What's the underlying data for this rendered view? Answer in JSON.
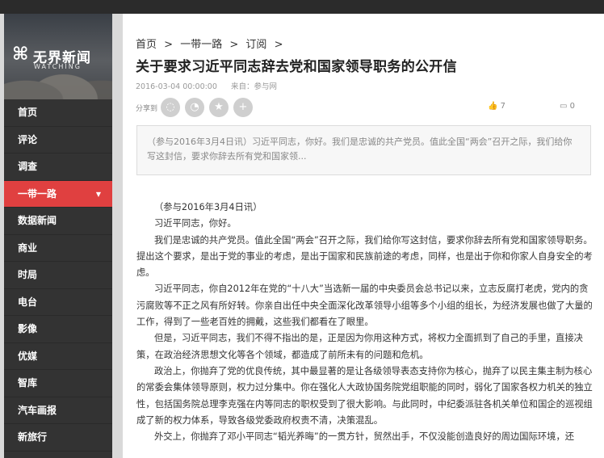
{
  "logo": {
    "name": "无界新闻",
    "sub": "WATCHING"
  },
  "nav": {
    "items": [
      {
        "label": "首页"
      },
      {
        "label": "评论"
      },
      {
        "label": "调查"
      },
      {
        "label": "一带一路",
        "active": true
      },
      {
        "label": "数据新闻"
      },
      {
        "label": "商业"
      },
      {
        "label": "时局"
      },
      {
        "label": "电台"
      },
      {
        "label": "影像"
      },
      {
        "label": "优媒"
      },
      {
        "label": "智库"
      },
      {
        "label": "汽车画报"
      },
      {
        "label": "新旅行"
      }
    ],
    "active_caret": "▼"
  },
  "breadcrumb": [
    "首页",
    ">",
    "一带一路",
    ">",
    "订阅",
    ">"
  ],
  "article": {
    "title": "关于要求习近平同志辞去党和国家领导职务的公开信",
    "date": "2016-03-04 00:00:00",
    "source": "来自：参与网",
    "share_label": "分享到",
    "likes": "7",
    "comments": "0",
    "summary": "（参与2016年3月4日讯）习近平同志，你好。我们是忠诚的共产党员。值此全国“两会”召开之际，我们给你写这封信，要求你辞去所有党和国家领...",
    "paragraphs": [
      "（参与2016年3月4日讯）",
      "习近平同志，你好。",
      "我们是忠诚的共产党员。值此全国“两会”召开之际，我们给你写这封信，要求你辞去所有党和国家领导职务。提出这个要求，是出于党的事业的考虑，是出于国家和民族前途的考虑，同样，也是出于你和你家人自身安全的考虑。",
      "习近平同志，你自2012年在党的“十八大”当选新一届的中央委员会总书记以来，立志反腐打老虎，党内的贪污腐败等不正之风有所好转。你亲自出任中央全面深化改革领导小组等多个小组的组长，为经济发展也做了大量的工作，得到了一些老百姓的拥戴，这些我们都看在了眼里。",
      "但是，习近平同志，我们不得不指出的是，正是因为你用这种方式，将权力全面抓到了自己的手里，直接决策，在政治经济思想文化等各个领域，都造成了前所未有的问题和危机。",
      "政治上，你抛弃了党的优良传统，其中最显著的是让各级领导表态支持你为核心，抛弃了以民主集主制为核心的常委会集体领导原则，权力过分集中。你在强化人大政协国务院党组职能的同时，弱化了国家各权力机关的独立性，包括国务院总理李克强在内等同志的职权受到了很大影响。与此同时，中纪委派驻各机关单位和国企的巡视组成了新的权力体系，导致各级党委政府权责不清，决策混乱。",
      "外交上，你抛弃了邓小平同志“韬光养晦”的一贯方针，贸然出手，不仅没能创造良好的周边国际环境，还"
    ]
  }
}
